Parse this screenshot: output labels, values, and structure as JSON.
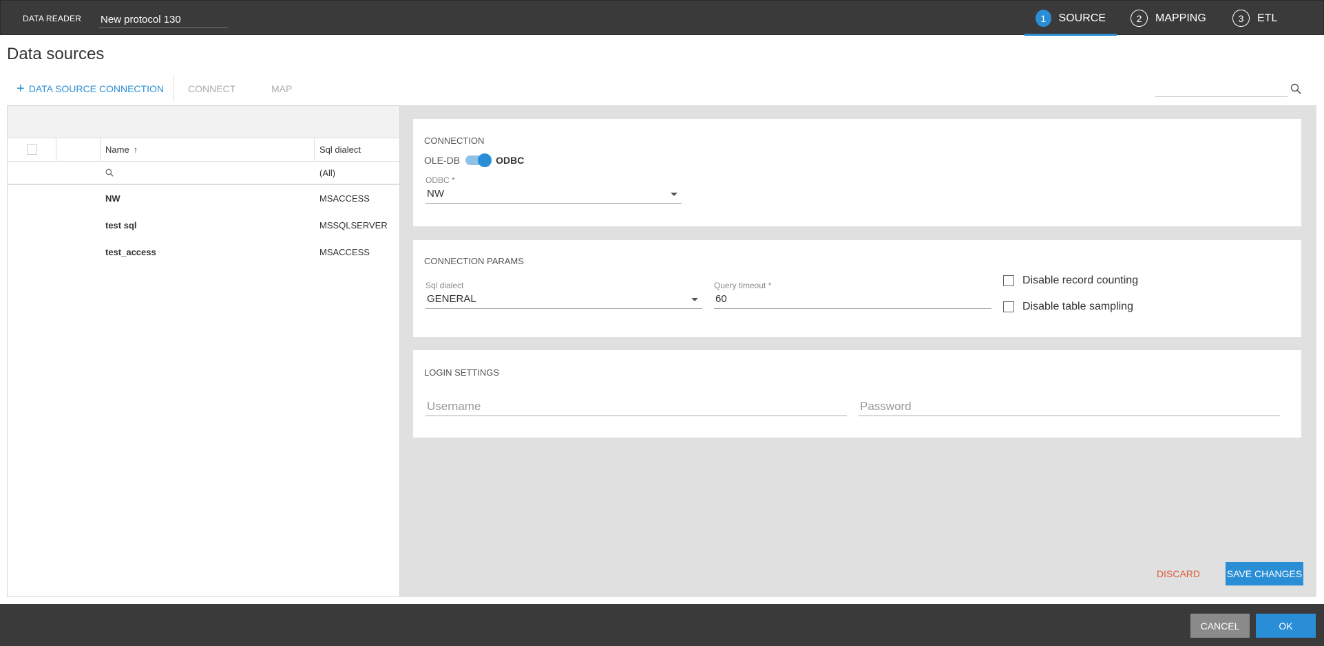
{
  "header": {
    "app_label": "DATA READER",
    "protocol_name": "New protocol 130",
    "steps": [
      {
        "num": "1",
        "label": "SOURCE",
        "active": true
      },
      {
        "num": "2",
        "label": "MAPPING",
        "active": false
      },
      {
        "num": "3",
        "label": "ETL",
        "active": false
      }
    ]
  },
  "page": {
    "title": "Data sources"
  },
  "toolbar": {
    "add_icon": "+",
    "add_label": "DATA SOURCE CONNECTION",
    "connect_label": "CONNECT",
    "map_label": "MAP",
    "search_placeholder": ""
  },
  "grid": {
    "columns": {
      "name": "Name",
      "sort_glyph": "↑",
      "dialect": "Sql dialect"
    },
    "filter": {
      "name": "",
      "dialect": "(All)"
    },
    "rows": [
      {
        "name": "NW",
        "dialect": "MSACCESS"
      },
      {
        "name": "test sql",
        "dialect": "MSSQLSERVER"
      },
      {
        "name": "test_access",
        "dialect": "MSACCESS"
      }
    ]
  },
  "connection": {
    "title": "CONNECTION",
    "toggle_off": "OLE-DB",
    "toggle_on": "ODBC",
    "toggle_state": "ODBC",
    "odbc_label": "ODBC",
    "required_mark": "*",
    "odbc_value": "NW"
  },
  "params": {
    "title": "CONNECTION PARAMS",
    "dialect_label": "Sql dialect",
    "dialect_value": "GENERAL",
    "timeout_label": "Query timeout",
    "required_mark": "*",
    "timeout_value": "60",
    "disable_counting": "Disable record counting",
    "disable_sampling": "Disable table sampling"
  },
  "login": {
    "title": "LOGIN SETTINGS",
    "username_placeholder": "Username",
    "password_placeholder": "Password"
  },
  "actions": {
    "discard": "DISCARD",
    "save": "SAVE CHANGES"
  },
  "footer": {
    "cancel": "CANCEL",
    "ok": "OK"
  },
  "colors": {
    "accent": "#2a8ed6",
    "danger": "#e05a3a",
    "bar": "#3a3a3a"
  }
}
